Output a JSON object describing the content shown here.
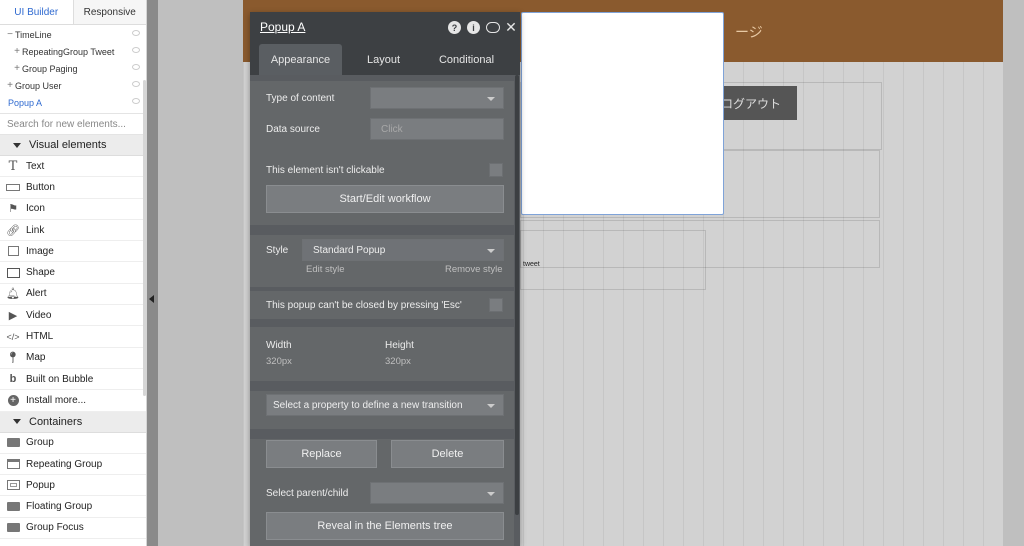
{
  "sidebar": {
    "tabs": [
      "UI Builder",
      "Responsive"
    ],
    "tree": [
      {
        "label": "TimeLine",
        "indent": 0,
        "prefix": "−"
      },
      {
        "label": "RepeatingGroup Tweet",
        "indent": 1,
        "prefix": "+"
      },
      {
        "label": "Group Paging",
        "indent": 1,
        "prefix": "+"
      },
      {
        "label": "Group User",
        "indent": 0,
        "prefix": "+"
      },
      {
        "label": "Popup A",
        "indent": 0,
        "prefix": ""
      }
    ],
    "search_placeholder": "Search for new elements...",
    "visual_category": "Visual elements",
    "visual_items": [
      {
        "label": "Text",
        "icon": "text-icon"
      },
      {
        "label": "Button",
        "icon": "button-icon"
      },
      {
        "label": "Icon",
        "icon": "flag-icon"
      },
      {
        "label": "Link",
        "icon": "link-icon"
      },
      {
        "label": "Image",
        "icon": "image-icon"
      },
      {
        "label": "Shape",
        "icon": "shape-icon"
      },
      {
        "label": "Alert",
        "icon": "bell-icon"
      },
      {
        "label": "Video",
        "icon": "video-icon"
      },
      {
        "label": "HTML",
        "icon": "code-icon"
      },
      {
        "label": "Map",
        "icon": "map-pin-icon"
      },
      {
        "label": "Built on Bubble",
        "icon": "bubble-logo-icon"
      },
      {
        "label": "Install more...",
        "icon": "plus-circle-icon"
      }
    ],
    "containers_category": "Containers",
    "container_items": [
      {
        "label": "Group",
        "icon": "folder-icon"
      },
      {
        "label": "Repeating Group",
        "icon": "repeating-group-icon"
      },
      {
        "label": "Popup",
        "icon": "popup-icon"
      },
      {
        "label": "Floating Group",
        "icon": "floating-group-icon"
      },
      {
        "label": "Group Focus",
        "icon": "group-focus-icon"
      }
    ]
  },
  "canvas": {
    "header_text": "ージ",
    "logout_label": "ログアウト",
    "tweet_label": "tweet"
  },
  "editor": {
    "title": "Popup A",
    "tabs": [
      "Appearance",
      "Layout",
      "Conditional"
    ],
    "active_tab": "Appearance",
    "type_of_content_label": "Type of content",
    "type_of_content_value": "",
    "data_source_label": "Data source",
    "data_source_placeholder": "Click",
    "not_clickable_label": "This element isn't clickable",
    "workflow_button": "Start/Edit workflow",
    "style_label": "Style",
    "style_value": "Standard Popup",
    "edit_style": "Edit style",
    "remove_style": "Remove style",
    "esc_label": "This popup can't be closed by pressing 'Esc'",
    "width_label": "Width",
    "width_value": "320px",
    "height_label": "Height",
    "height_value": "320px",
    "transition_placeholder": "Select a property to define a new transition",
    "replace_button": "Replace",
    "delete_button": "Delete",
    "parent_child_label": "Select parent/child",
    "reveal_button": "Reveal in the Elements tree"
  },
  "colors": {
    "accent_blue": "#2f6ad0",
    "editor_bg": "#4a4d50",
    "header_brown": "#8a5a2e"
  }
}
